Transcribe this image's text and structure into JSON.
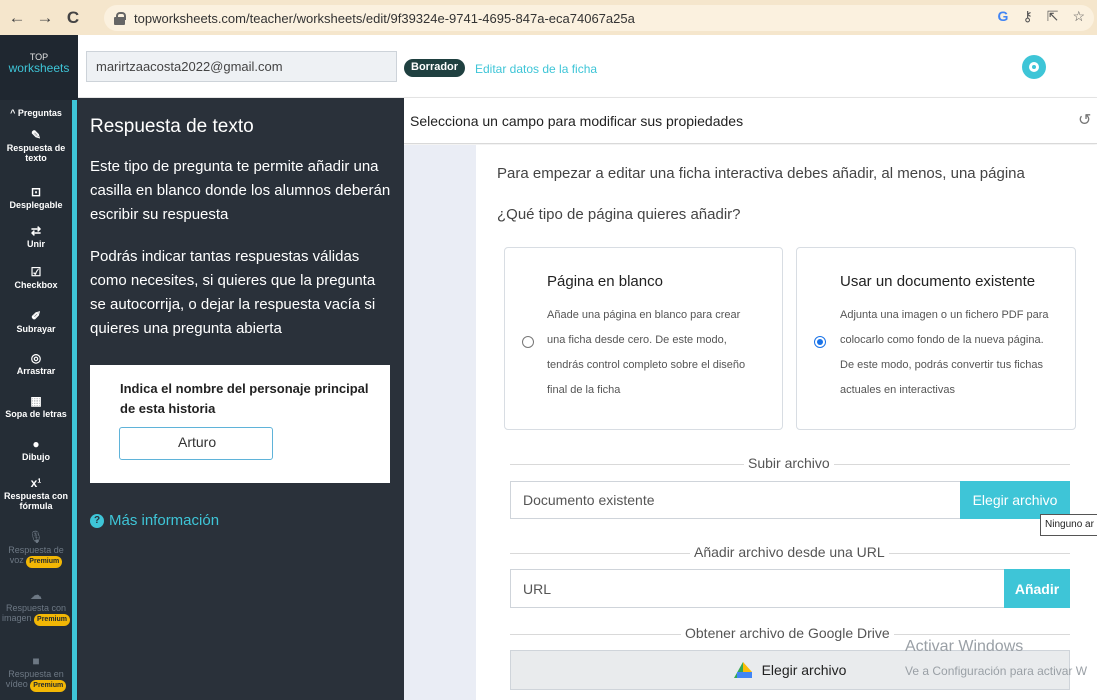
{
  "browser": {
    "url": "topworksheets.com/teacher/worksheets/edit/9f39324e-9741-4695-847a-eca74067a25a",
    "back_icon": "arrow-left",
    "forward_icon": "arrow-right",
    "reload_icon": "reload"
  },
  "logo": {
    "top": "TOP",
    "main": "worksheets"
  },
  "header": {
    "email": "marirtzaacosta2022@gmail.com",
    "status_badge": "Borrador",
    "edit_link": "Editar datos de la ficha"
  },
  "sidebar": {
    "section_label": "^ Preguntas",
    "items": [
      {
        "label": "Respuesta de texto",
        "icon": "edit-icon"
      },
      {
        "label": "Desplegable",
        "icon": "dropdown-icon"
      },
      {
        "label": "Unir",
        "icon": "arrows-icon"
      },
      {
        "label": "Checkbox",
        "icon": "checkbox-icon"
      },
      {
        "label": "Subrayar",
        "icon": "marker-icon"
      },
      {
        "label": "Arrastrar",
        "icon": "drag-icon"
      },
      {
        "label": "Sopa de letras",
        "icon": "grid-icon"
      },
      {
        "label": "Dibujo",
        "icon": "palette-icon"
      },
      {
        "label": "Respuesta con fórmula",
        "icon": "formula-icon"
      },
      {
        "label": "Respuesta de voz",
        "icon": "microphone-icon",
        "badge": "Premium"
      },
      {
        "label": "Respuesta con imagen",
        "icon": "upload-icon",
        "badge": "Premium"
      },
      {
        "label": "Respuesta en vídeo",
        "icon": "video-icon",
        "badge": "Premium"
      }
    ]
  },
  "help": {
    "title": "Respuesta de texto",
    "description": "Este tipo de pregunta te permite añadir una casilla en blanco donde los alumnos deberán escribir su respuesta",
    "description2": "Podrás indicar tantas respuestas válidas como necesites, si quieres que la pregunta se autocorrija, o dejar la respuesta vacía si quieres una pregunta abierta",
    "example_question": "Indica el nombre del personaje principal de esta historia",
    "example_answer": "Arturo",
    "more_info": "Más información"
  },
  "property_bar": {
    "text": "Selecciona un campo para modificar sus propiedades"
  },
  "main": {
    "intro": "Para empezar a editar una ficha interactiva debes añadir, al menos, una página",
    "question": "¿Qué tipo de página quieres añadir?",
    "options": [
      {
        "title": "Página en blanco",
        "desc_lines": [
          "Añade una página en blanco para crear",
          "una ficha desde cero. De este modo,",
          "tendrás control completo sobre el diseño",
          "final de la ficha"
        ],
        "selected": false
      },
      {
        "title": "Usar un documento existente",
        "desc_lines": [
          "Adjunta una imagen o un fichero PDF para",
          "colocarlo como fondo de la nueva página.",
          "De este modo, podrás convertir tus fichas",
          "actuales en interactivas"
        ],
        "selected": true
      }
    ],
    "upload_section": "Subir archivo",
    "upload_field": "Documento existente",
    "upload_button": "Elegir archivo",
    "upload_tooltip": "Ninguno ar",
    "url_section": "Añadir archivo desde una URL",
    "url_placeholder": "URL",
    "url_button": "Añadir",
    "drive_section": "Obtener archivo de Google Drive",
    "drive_button": "Elegir archivo"
  },
  "watermark": {
    "line1": "Activar Windows",
    "line2": "Ve a Configuración para activar W"
  }
}
